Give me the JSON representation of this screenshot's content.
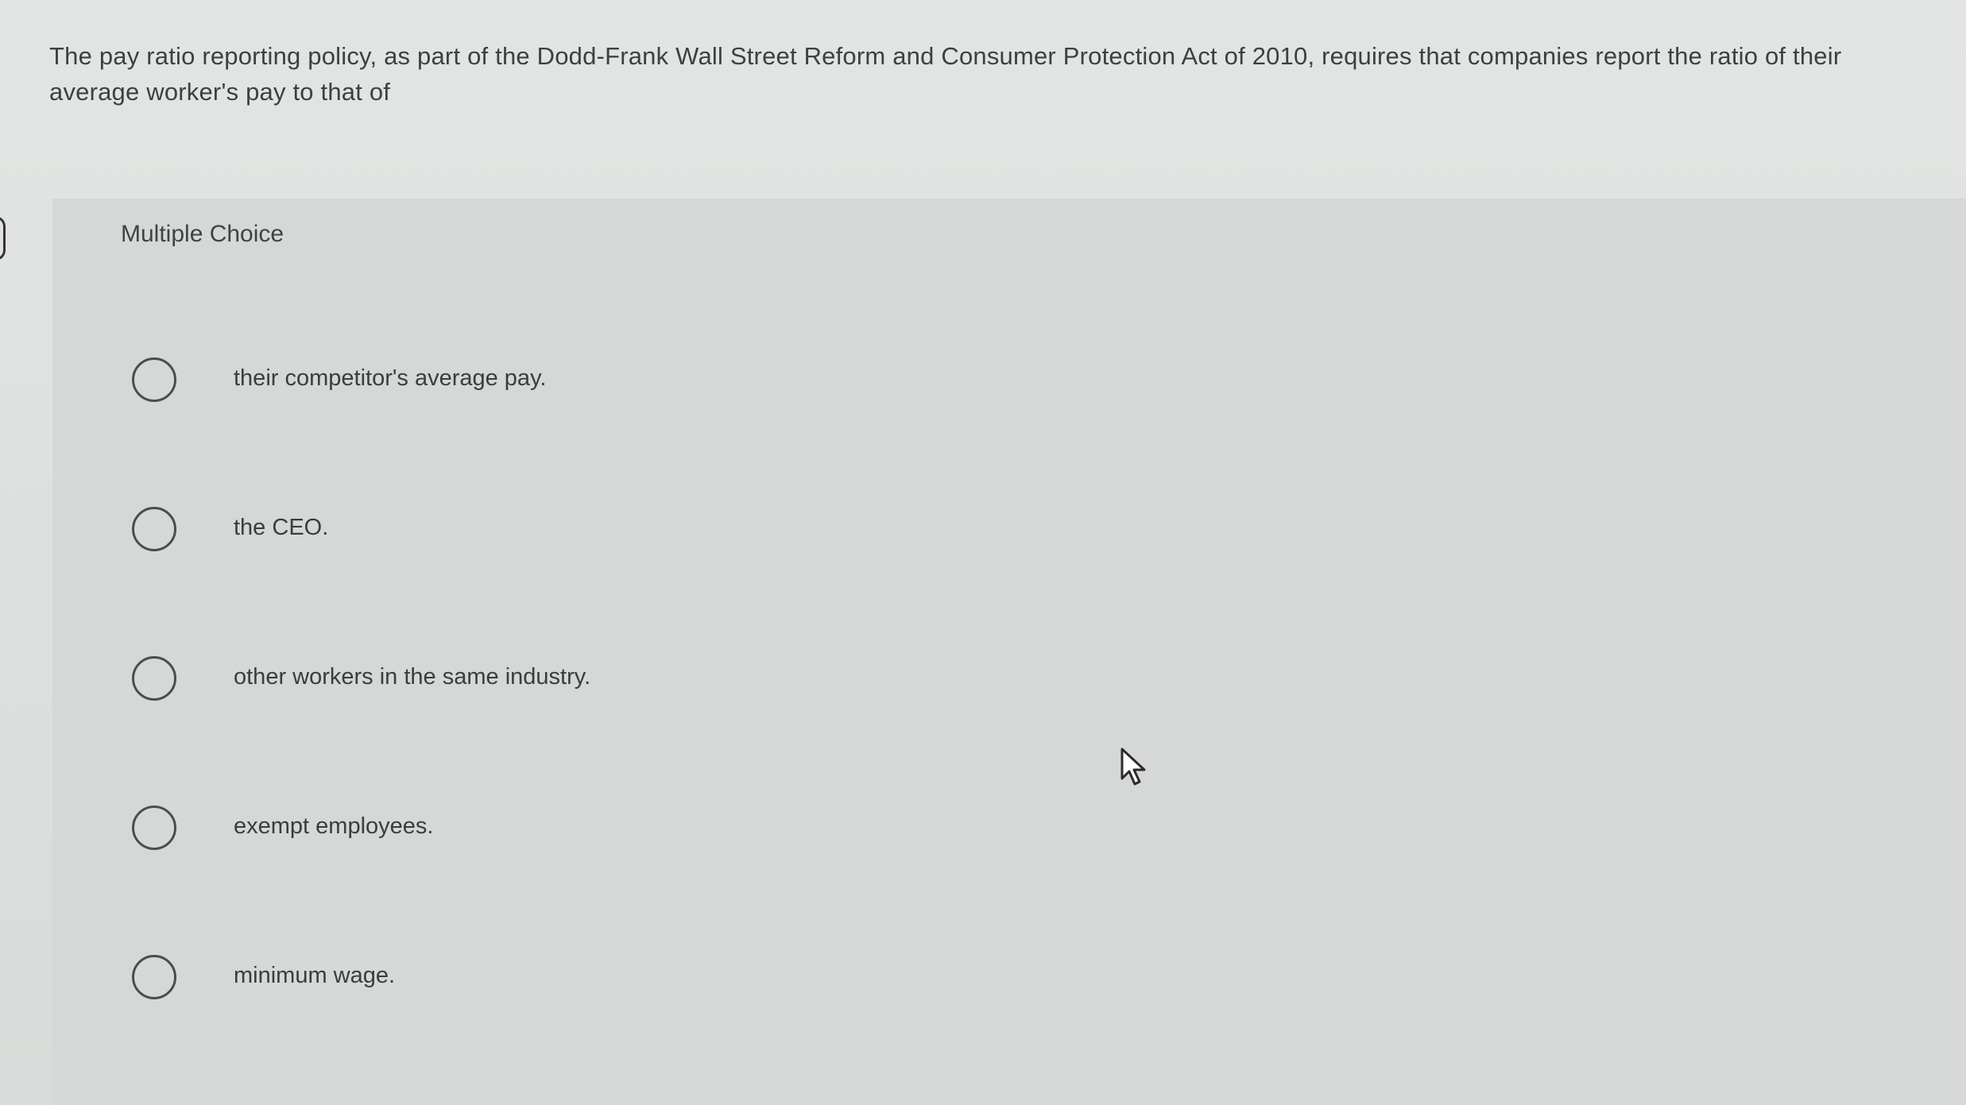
{
  "question": {
    "text": "The pay ratio reporting policy, as part of the Dodd-Frank Wall Street Reform and Consumer Protection Act of 2010, requires that companies report the ratio of their average worker's pay to that of"
  },
  "panel": {
    "label": "Multiple Choice",
    "options": [
      {
        "label": "their competitor's average pay."
      },
      {
        "label": "the CEO."
      },
      {
        "label": "other workers in the same industry."
      },
      {
        "label": "exempt employees."
      },
      {
        "label": "minimum wage."
      }
    ]
  },
  "icons": {
    "radio": "radio-unselected-icon",
    "cursor": "mouse-pointer-icon"
  },
  "colors": {
    "background": "#dfe1e0",
    "text": "#3d3f41",
    "radio_border": "#4a4c4e"
  }
}
